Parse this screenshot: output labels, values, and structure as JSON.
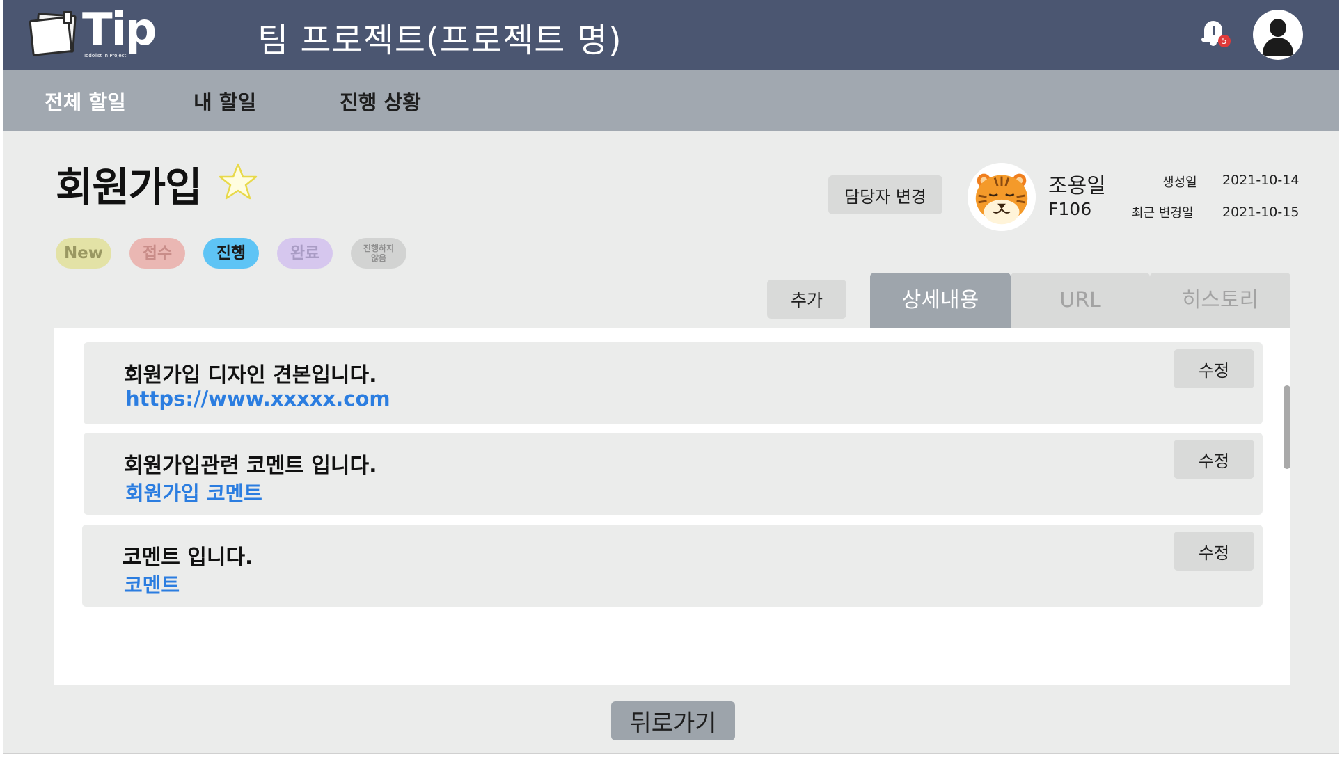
{
  "header": {
    "logo_text": "Tip",
    "logo_subtext": "Todolist In Project",
    "title": "팀 프로젝트(프로젝트 명)",
    "notification_count": "5"
  },
  "nav": {
    "items": [
      {
        "label": "전체 할일"
      },
      {
        "label": "내 할일"
      },
      {
        "label": "진행 상황"
      }
    ]
  },
  "task": {
    "title": "회원가입",
    "favorite": false,
    "status_pills": [
      {
        "label": "New",
        "bg": "#e3e2a6",
        "color": "#9a9862"
      },
      {
        "label": "접수",
        "bg": "#eab7b3",
        "color": "#c98d89"
      },
      {
        "label": "진행",
        "bg": "#5ec4f5",
        "color": "#1a1a1a"
      },
      {
        "label": "완료",
        "bg": "#d6c7ee",
        "color": "#a99cc4"
      },
      {
        "label": "진행하지\n않음",
        "bg": "#d2d3d2",
        "color": "#8f8f8f"
      }
    ],
    "change_assignee_label": "담당자 변경",
    "assignee": {
      "name": "조용일",
      "code": "F106"
    },
    "created_label": "생성일",
    "created_date": "2021-10-14",
    "updated_label": "최근 변경일",
    "updated_date": "2021-10-15"
  },
  "toolbar": {
    "add_label": "추가",
    "tabs": [
      {
        "label": "상세내용",
        "active": true
      },
      {
        "label": "URL",
        "active": false
      },
      {
        "label": "히스토리",
        "active": false
      }
    ]
  },
  "details": {
    "edit_label": "수정",
    "items": [
      {
        "text": "회원가입 디자인 견본입니다.",
        "link": "https://www.xxxxx.com"
      },
      {
        "text": "회원가입관련 코멘트 입니다.",
        "link": "회원가입 코멘트"
      },
      {
        "text": "코멘트 입니다.",
        "link": "코멘트"
      }
    ]
  },
  "footer": {
    "back_label": "뒤로가기"
  },
  "colors": {
    "header_bg": "#4b5671",
    "nav_bg": "#a1a8b0",
    "link": "#2b7de0",
    "active_tab": "#9ea5ac"
  }
}
